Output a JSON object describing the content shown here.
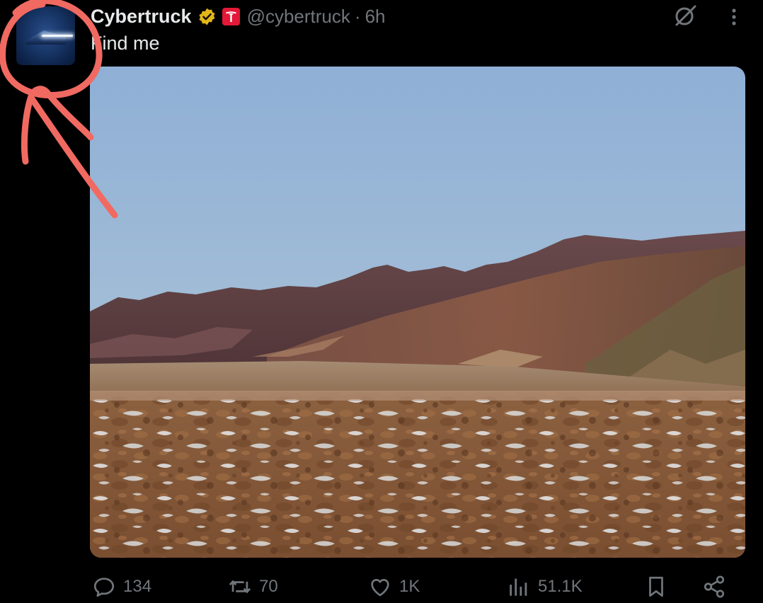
{
  "tweet": {
    "display_name": "Cybertruck",
    "handle": "@cybertruck",
    "separator": "·",
    "time": "6h",
    "text": "Find me",
    "media_alt": "Desert mountain landscape with salt flats",
    "avatar_alt": "Cybertruck avatar"
  },
  "actions": {
    "replies": "134",
    "reposts": "70",
    "likes": "1K",
    "views": "51.1K"
  },
  "colors": {
    "background": "#000000",
    "text": "#e7e9ea",
    "muted": "#71767b",
    "verified_gold": "#e2b719",
    "affiliate_red": "#e31937",
    "annotation": "#f06a62"
  },
  "icons": [
    "verified-gold-icon",
    "tesla-affiliate-icon",
    "grok-icon",
    "more-icon",
    "reply-icon",
    "repost-icon",
    "like-icon",
    "views-icon",
    "bookmark-icon",
    "share-icon"
  ]
}
